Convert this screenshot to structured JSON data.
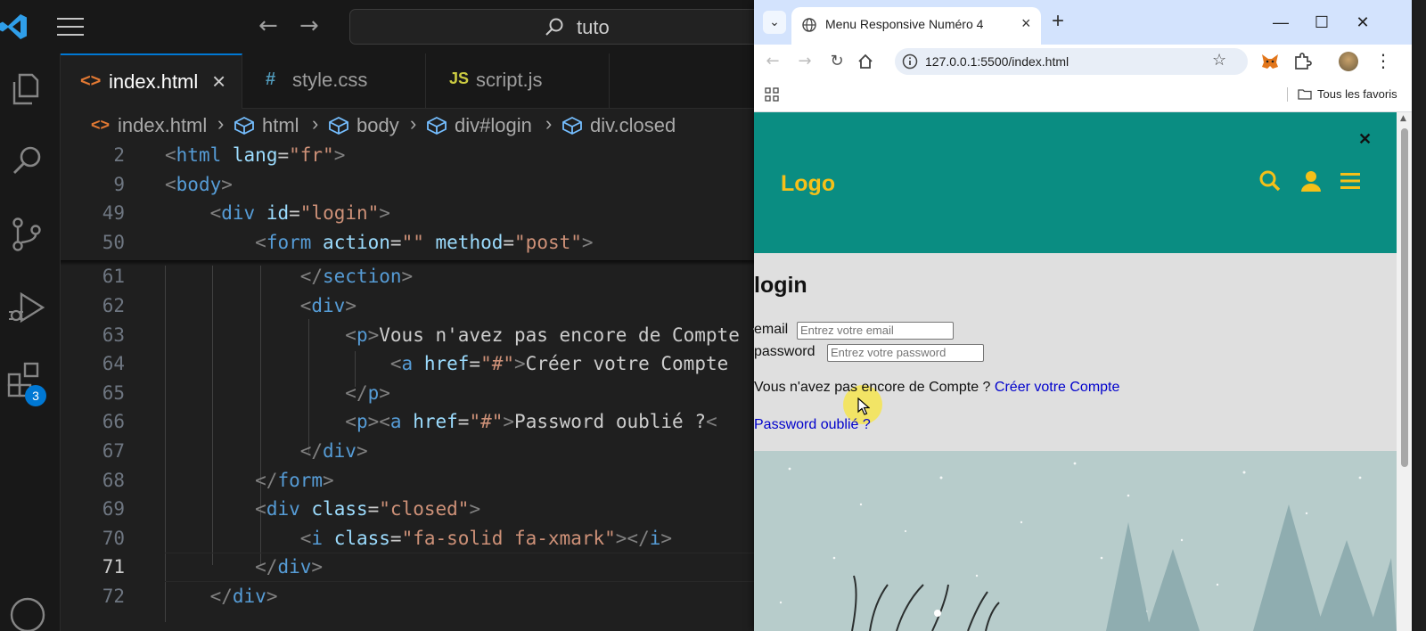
{
  "vscode": {
    "command_center": "tuto",
    "tabs": [
      {
        "icon": "<>",
        "label": "index.html",
        "active": true
      },
      {
        "icon": "#",
        "label": "style.css"
      },
      {
        "icon": "JS",
        "label": "script.js"
      }
    ],
    "breadcrumb": [
      "index.html",
      "html",
      "body",
      "div#login",
      "div.closed"
    ],
    "badge_count": "3",
    "lines": [
      {
        "n": "2",
        "sticky": true,
        "tokens": [
          [
            "t-punc",
            "<"
          ],
          [
            "t-tag",
            "html"
          ],
          [
            "t-txt",
            " "
          ],
          [
            "t-attr",
            "lang"
          ],
          [
            "t-txt",
            "="
          ],
          [
            "t-str",
            "\"fr\""
          ],
          [
            "t-punc",
            ">"
          ]
        ]
      },
      {
        "n": "9",
        "sticky": true,
        "tokens": [
          [
            "t-punc",
            "<"
          ],
          [
            "t-tag",
            "body"
          ],
          [
            "t-punc",
            ">"
          ]
        ]
      },
      {
        "n": "49",
        "sticky": true,
        "tokens": [
          [
            "t-txt",
            "    "
          ],
          [
            "t-punc",
            "<"
          ],
          [
            "t-tag",
            "div"
          ],
          [
            "t-txt",
            " "
          ],
          [
            "t-attr",
            "id"
          ],
          [
            "t-txt",
            "="
          ],
          [
            "t-str",
            "\"login\""
          ],
          [
            "t-punc",
            ">"
          ]
        ]
      },
      {
        "n": "50",
        "sticky": true,
        "tokens": [
          [
            "t-txt",
            "        "
          ],
          [
            "t-punc",
            "<"
          ],
          [
            "t-tag",
            "form"
          ],
          [
            "t-txt",
            " "
          ],
          [
            "t-attr",
            "action"
          ],
          [
            "t-txt",
            "="
          ],
          [
            "t-str",
            "\"\""
          ],
          [
            "t-txt",
            " "
          ],
          [
            "t-attr",
            "method"
          ],
          [
            "t-txt",
            "="
          ],
          [
            "t-str",
            "\"post\""
          ],
          [
            "t-punc",
            ">"
          ]
        ]
      },
      {
        "n": "61",
        "tokens": [
          [
            "t-txt",
            "            "
          ],
          [
            "t-punc",
            "</"
          ],
          [
            "t-tag",
            "section"
          ],
          [
            "t-punc",
            ">"
          ]
        ]
      },
      {
        "n": "62",
        "tokens": [
          [
            "t-txt",
            "            "
          ],
          [
            "t-punc",
            "<"
          ],
          [
            "t-tag",
            "div"
          ],
          [
            "t-punc",
            ">"
          ]
        ]
      },
      {
        "n": "63",
        "tokens": [
          [
            "t-txt",
            "                "
          ],
          [
            "t-punc",
            "<"
          ],
          [
            "t-tag",
            "p"
          ],
          [
            "t-punc",
            ">"
          ],
          [
            "t-txt",
            "Vous n'avez pas encore de Compte ? "
          ]
        ]
      },
      {
        "n": "64",
        "tokens": [
          [
            "t-txt",
            "                    "
          ],
          [
            "t-punc",
            "<"
          ],
          [
            "t-tag",
            "a"
          ],
          [
            "t-txt",
            " "
          ],
          [
            "t-attr",
            "href"
          ],
          [
            "t-txt",
            "="
          ],
          [
            "t-str",
            "\"#\""
          ],
          [
            "t-punc",
            ">"
          ],
          [
            "t-txt",
            "Créer votre Compte"
          ]
        ]
      },
      {
        "n": "65",
        "tokens": [
          [
            "t-txt",
            "                "
          ],
          [
            "t-punc",
            "</"
          ],
          [
            "t-tag",
            "p"
          ],
          [
            "t-punc",
            ">"
          ]
        ]
      },
      {
        "n": "66",
        "tokens": [
          [
            "t-txt",
            "                "
          ],
          [
            "t-punc",
            "<"
          ],
          [
            "t-tag",
            "p"
          ],
          [
            "t-punc",
            "><"
          ],
          [
            "t-tag",
            "a"
          ],
          [
            "t-txt",
            " "
          ],
          [
            "t-attr",
            "href"
          ],
          [
            "t-txt",
            "="
          ],
          [
            "t-str",
            "\"#\""
          ],
          [
            "t-punc",
            ">"
          ],
          [
            "t-txt",
            "Password oublié ?"
          ],
          [
            "t-punc",
            "<"
          ]
        ]
      },
      {
        "n": "67",
        "tokens": [
          [
            "t-txt",
            "            "
          ],
          [
            "t-punc",
            "</"
          ],
          [
            "t-tag",
            "div"
          ],
          [
            "t-punc",
            ">"
          ]
        ]
      },
      {
        "n": "68",
        "tokens": [
          [
            "t-txt",
            "        "
          ],
          [
            "t-punc",
            "</"
          ],
          [
            "t-tag",
            "form"
          ],
          [
            "t-punc",
            ">"
          ]
        ]
      },
      {
        "n": "69",
        "tokens": [
          [
            "t-txt",
            "        "
          ],
          [
            "t-punc",
            "<"
          ],
          [
            "t-tag",
            "div"
          ],
          [
            "t-txt",
            " "
          ],
          [
            "t-attr",
            "class"
          ],
          [
            "t-txt",
            "="
          ],
          [
            "t-str",
            "\"closed\""
          ],
          [
            "t-punc",
            ">"
          ]
        ]
      },
      {
        "n": "70",
        "tokens": [
          [
            "t-txt",
            "            "
          ],
          [
            "t-punc",
            "<"
          ],
          [
            "t-tag",
            "i"
          ],
          [
            "t-txt",
            " "
          ],
          [
            "t-attr",
            "class"
          ],
          [
            "t-txt",
            "="
          ],
          [
            "t-str",
            "\"fa-solid fa-xmark\""
          ],
          [
            "t-punc",
            "></"
          ],
          [
            "t-tag",
            "i"
          ],
          [
            "t-punc",
            ">"
          ]
        ]
      },
      {
        "n": "71",
        "current": true,
        "tokens": [
          [
            "t-txt",
            "        "
          ],
          [
            "t-punc",
            "</"
          ],
          [
            "t-tag",
            "div"
          ],
          [
            "t-punc",
            ">"
          ]
        ]
      },
      {
        "n": "72",
        "tokens": [
          [
            "t-txt",
            "    "
          ],
          [
            "t-punc",
            "</"
          ],
          [
            "t-tag",
            "div"
          ],
          [
            "t-punc",
            ">"
          ]
        ]
      }
    ]
  },
  "browser": {
    "tab_title": "Menu Responsive Numéro 4",
    "url": "127.0.0.1:5500/index.html",
    "bookmarks_folder": "Tous les favoris",
    "page": {
      "logo": "Logo",
      "close_glyph": "✕",
      "login_title": "login",
      "email_label": "email",
      "email_placeholder": "Entrez votre email",
      "password_label": "password",
      "password_placeholder": "Entrez votre password",
      "no_account_text": "Vous n'avez pas encore de Compte ?",
      "create_account_link": "Créer votre Compte",
      "forgot_password_link": "Password oublié ?"
    }
  },
  "colors": {
    "header_bg": "#0a8d82",
    "logo_color": "#f5c019",
    "accent_blue": "#0078d4"
  }
}
